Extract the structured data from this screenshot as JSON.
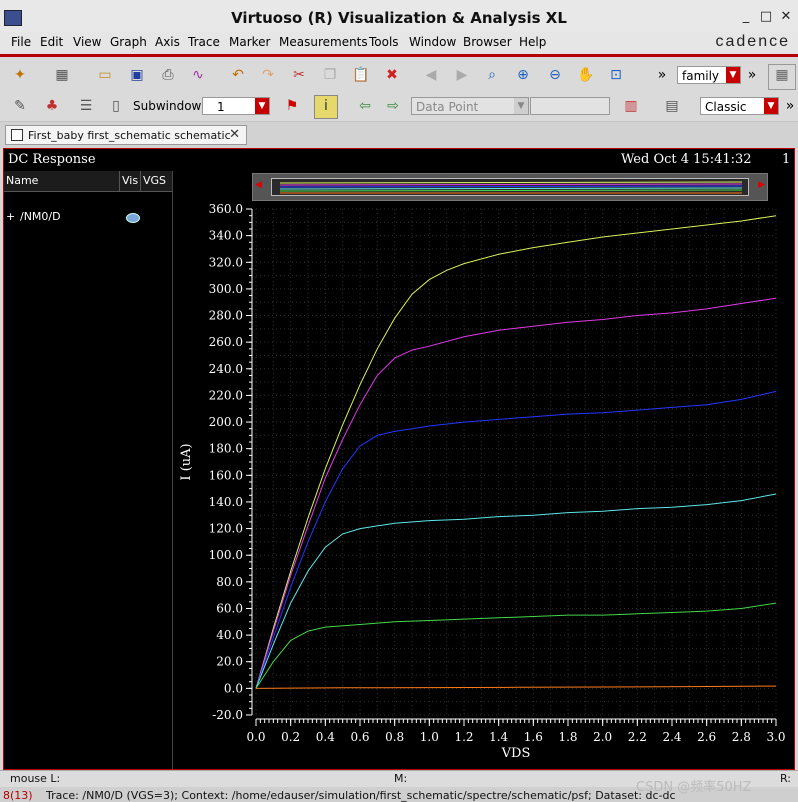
{
  "window": {
    "title": "Virtuoso (R) Visualization & Analysis XL"
  },
  "menu": {
    "items": [
      "File",
      "Edit",
      "View",
      "Graph",
      "Axis",
      "Trace",
      "Marker",
      "Measurements",
      "Tools",
      "Window",
      "Browser",
      "Help"
    ],
    "brand": "cadence"
  },
  "toolbar": {
    "family_combo": "family",
    "subwindows_label": "Subwindows:",
    "subwindows_value": "1",
    "datapoint_combo": "Data Point",
    "style_combo": "Classic"
  },
  "tab": {
    "label": "First_baby first_schematic schematic"
  },
  "plot": {
    "window_title": "DC Response",
    "date": "Wed Oct 4 15:41:32",
    "subwindow_number": "1",
    "legend_headers": {
      "name": "Name",
      "vis": "Vis",
      "vgs": "VGS"
    },
    "trace_name": "/NM0/D"
  },
  "status": {
    "mouse": "mouse L:",
    "middle": "M:",
    "right": "R:",
    "count": "8(13)",
    "message": "Trace: /NM0/D (VGS=3); Context: /home/edauser/simulation/first_schematic/spectre/schematic/psf; Dataset: dc-dc"
  },
  "watermark": "CSDN @频率50HZ",
  "colors": {
    "accent": "#b40000",
    "plot_bg": "#000000",
    "grid": "#2e2e2e"
  },
  "chart_data": {
    "type": "line",
    "title": "DC Response",
    "xlabel": "VDS",
    "ylabel": "I (uA)",
    "xlim": [
      0,
      3.0
    ],
    "ylim": [
      -20,
      360
    ],
    "xticks": [
      "0.0",
      "0.2",
      "0.4",
      "0.6",
      "0.8",
      "1.0",
      "1.2",
      "1.4",
      "1.6",
      "1.8",
      "2.0",
      "2.2",
      "2.4",
      "2.6",
      "2.8",
      "3.0"
    ],
    "yticks": [
      "-20.0",
      "0.0",
      "20.0",
      "40.0",
      "60.0",
      "80.0",
      "100.0",
      "120.0",
      "140.0",
      "160.0",
      "180.0",
      "200.0",
      "220.0",
      "240.0",
      "260.0",
      "280.0",
      "300.0",
      "320.0",
      "340.0",
      "360.0"
    ],
    "grid": true,
    "series": [
      {
        "color": "#d8f25a",
        "x": [
          0,
          0.1,
          0.2,
          0.3,
          0.4,
          0.5,
          0.6,
          0.7,
          0.8,
          0.9,
          1.0,
          1.1,
          1.2,
          1.4,
          1.6,
          1.8,
          2.0,
          2.2,
          2.4,
          2.6,
          2.8,
          3.0
        ],
        "y": [
          0,
          45,
          88,
          128,
          165,
          198,
          228,
          255,
          278,
          296,
          307,
          314,
          319,
          326,
          331,
          335,
          339,
          342,
          345,
          348,
          351,
          355
        ]
      },
      {
        "color": "#e03ae8",
        "x": [
          0,
          0.1,
          0.2,
          0.3,
          0.4,
          0.5,
          0.6,
          0.7,
          0.8,
          0.9,
          1.0,
          1.2,
          1.4,
          1.6,
          1.8,
          2.0,
          2.2,
          2.4,
          2.6,
          2.8,
          3.0
        ],
        "y": [
          0,
          43,
          85,
          122,
          158,
          187,
          213,
          235,
          248,
          254,
          257,
          264,
          269,
          272,
          275,
          277,
          280,
          282,
          285,
          289,
          293
        ]
      },
      {
        "color": "#2436ff",
        "x": [
          0,
          0.1,
          0.2,
          0.3,
          0.4,
          0.5,
          0.6,
          0.7,
          0.8,
          0.9,
          1.0,
          1.2,
          1.4,
          1.6,
          1.8,
          2.0,
          2.2,
          2.4,
          2.6,
          2.8,
          3.0
        ],
        "y": [
          0,
          38,
          76,
          110,
          140,
          165,
          182,
          190,
          193,
          195,
          197,
          200,
          202,
          204,
          206,
          207,
          209,
          211,
          213,
          217,
          223
        ]
      },
      {
        "color": "#5ee6e6",
        "x": [
          0,
          0.1,
          0.2,
          0.3,
          0.4,
          0.5,
          0.6,
          0.7,
          0.8,
          1.0,
          1.2,
          1.4,
          1.6,
          1.8,
          2.0,
          2.2,
          2.4,
          2.6,
          2.8,
          3.0
        ],
        "y": [
          0,
          33,
          64,
          88,
          106,
          116,
          120,
          122,
          124,
          126,
          127,
          129,
          130,
          132,
          133,
          135,
          136,
          138,
          141,
          146
        ]
      },
      {
        "color": "#44d848",
        "x": [
          0,
          0.1,
          0.2,
          0.3,
          0.4,
          0.6,
          0.8,
          1.0,
          1.2,
          1.4,
          1.6,
          1.8,
          2.0,
          2.2,
          2.4,
          2.6,
          2.8,
          3.0
        ],
        "y": [
          0,
          20,
          36,
          43,
          46,
          48,
          50,
          51,
          52,
          53,
          54,
          55,
          55,
          56,
          57,
          58,
          60,
          64
        ]
      },
      {
        "color": "#ff7a1a",
        "x": [
          0,
          0.5,
          1.0,
          1.5,
          2.0,
          2.5,
          3.0
        ],
        "y": [
          0,
          0.4,
          0.6,
          0.8,
          1.0,
          1.3,
          1.7
        ]
      }
    ]
  }
}
